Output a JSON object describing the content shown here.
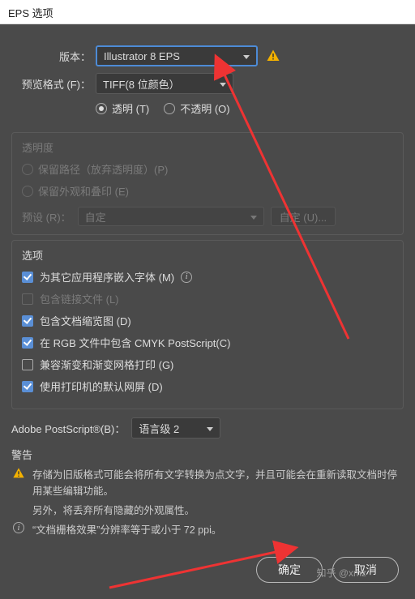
{
  "window": {
    "title": "EPS 选项"
  },
  "top": {
    "version_label": "版本：",
    "version_value": "Illustrator 8 EPS",
    "preview_label": "预览格式 (F)：",
    "preview_value": "TIFF(8 位颜色）",
    "radio_transparent": "透明 (T)",
    "radio_opaque": "不透明 (O)"
  },
  "transparency": {
    "title": "透明度",
    "opt1": "保留路径（放弃透明度）(P)",
    "opt2": "保留外观和叠印 (E)",
    "preset_label": "预设 (R)：",
    "preset_value": "自定",
    "custom_btn": "自定 (U)..."
  },
  "options": {
    "title": "选项",
    "items": [
      {
        "label": "为其它应用程序嵌入字体 (M)",
        "checked": true,
        "info": true,
        "disabled": false
      },
      {
        "label": "包含链接文件 (L)",
        "checked": false,
        "info": false,
        "disabled": true
      },
      {
        "label": "包含文档缩览图 (D)",
        "checked": true,
        "info": false,
        "disabled": false
      },
      {
        "label": "在 RGB 文件中包含 CMYK PostScript(C)",
        "checked": true,
        "info": false,
        "disabled": false
      },
      {
        "label": "兼容渐变和渐变网格打印 (G)",
        "checked": false,
        "info": false,
        "disabled": false
      },
      {
        "label": "使用打印机的默认网屏 (D)",
        "checked": true,
        "info": false,
        "disabled": false
      }
    ]
  },
  "postscript": {
    "label": "Adobe PostScript®(B)：",
    "value": "语言级 2"
  },
  "warnings": {
    "title": "警告",
    "lines": [
      "存储为旧版格式可能会将所有文字转换为点文字，并且可能会在重新读取文档时停用某些编辑功能。",
      "另外，将丢弃所有隐藏的外观属性。",
      "“文档栅格效果”分辨率等于或小于 72 ppi。"
    ]
  },
  "buttons": {
    "ok": "确定",
    "cancel": "取消"
  },
  "watermark": "知乎 @xmz"
}
